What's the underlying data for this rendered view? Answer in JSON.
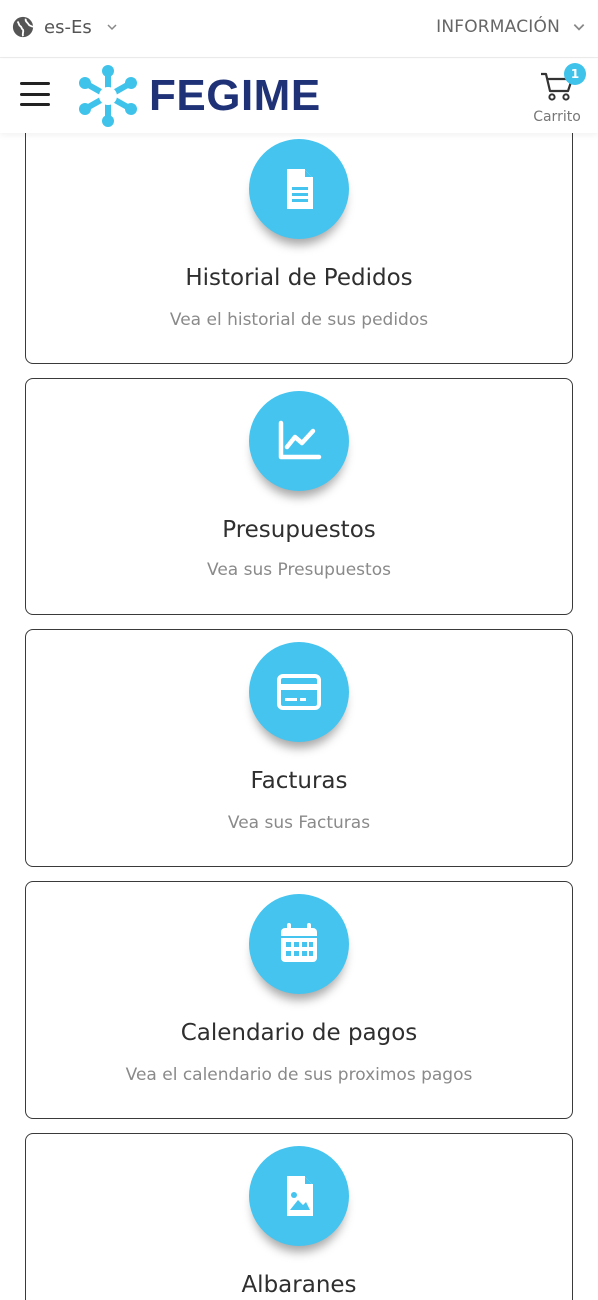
{
  "topbar": {
    "language": "es-Es",
    "info_menu": "INFORMACIÓN"
  },
  "header": {
    "brand": "FEGIME",
    "cart_count": "1",
    "cart_label": "Carrito"
  },
  "colors": {
    "accent": "#45c4ef",
    "brand": "#1f3277"
  },
  "cards": [
    {
      "title": "Historial de Pedidos",
      "description": "Vea el historial de sus pedidos",
      "icon": "document-icon"
    },
    {
      "title": "Presupuestos",
      "description": "Vea sus Presupuestos",
      "icon": "line-chart-icon"
    },
    {
      "title": "Facturas",
      "description": "Vea sus Facturas",
      "icon": "credit-card-icon"
    },
    {
      "title": "Calendario de pagos",
      "description": "Vea el calendario de sus proximos pagos",
      "icon": "calendar-icon"
    },
    {
      "title": "Albaranes",
      "description": "",
      "icon": "image-file-icon"
    }
  ]
}
